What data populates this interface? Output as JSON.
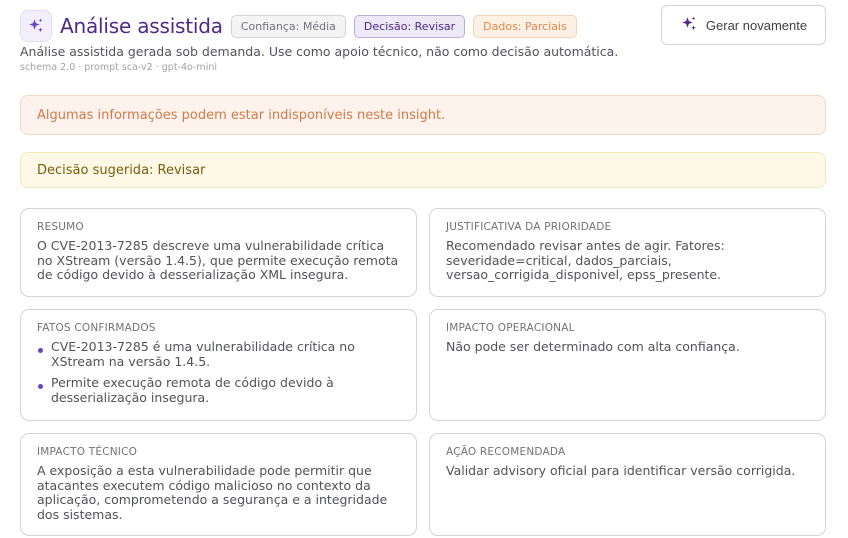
{
  "header": {
    "title": "Análise assistida",
    "badges": {
      "confidence": "Confiança: Média",
      "decision": "Decisão: Revisar",
      "data": "Dados: Parciais"
    },
    "regenerate_label": "Gerar novamente"
  },
  "subtitle": "Análise assistida gerada sob demanda. Use como apoio técnico, não como decisão automática.",
  "meta": "schema 2.0 · prompt sca-v2 · gpt-4o-mini",
  "alerts": {
    "warning": "Algumas informações podem estar indisponíveis neste insight.",
    "decision": "Decisão sugerida: Revisar"
  },
  "cards": {
    "summary": {
      "label": "Resumo",
      "text": "O CVE-2013-7285 descreve uma vulnerabilidade crítica no XStream (versão 1.4.5), que permite execução remota de código devido à desserialização XML insegura."
    },
    "priority": {
      "label": "Justificativa da prioridade",
      "text": "Recomendado revisar antes de agir. Fatores: severidade=critical, dados_parciais, versao_corrigida_disponivel, epss_presente."
    },
    "facts": {
      "label": "Fatos confirmados",
      "items": [
        "CVE-2013-7285 é uma vulnerabilidade crítica no XStream na versão 1.4.5.",
        "Permite execução remota de código devido à desserialização insegura."
      ]
    },
    "operational": {
      "label": "Impacto operacional",
      "text": "Não pode ser determinado com alta confiança."
    },
    "technical": {
      "label": "Impacto técnico",
      "text": "A exposição a esta vulnerabilidade pode permitir que atacantes executem código malicioso no contexto da aplicação, comprometendo a segurança e a integridade dos sistemas."
    },
    "action": {
      "label": "Ação recomendada",
      "text": "Validar advisory oficial para identificar versão corrigida."
    }
  },
  "colors": {
    "brand": "#4c2a85",
    "accent": "#6b46c1",
    "warning_bg": "#fdf3ec",
    "warning_text": "#d07a4a",
    "decision_bg": "#fdf9e6",
    "decision_text": "#7a5c10"
  },
  "icons": {
    "logo": "sparkles-icon",
    "regenerate": "sparkles-icon"
  }
}
